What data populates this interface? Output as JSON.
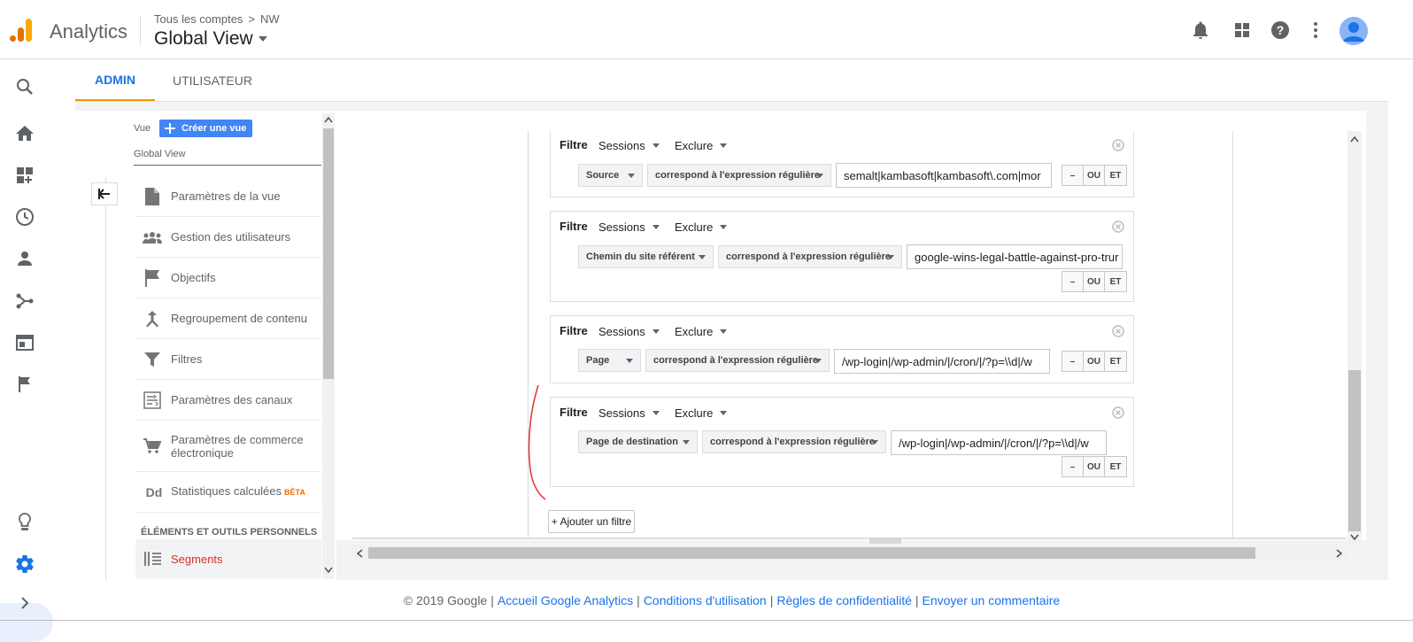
{
  "header": {
    "app_name": "Analytics",
    "breadcrumb_root": "Tous les comptes",
    "breadcrumb_sep": ">",
    "breadcrumb_account": "NW",
    "view_title": "Global View"
  },
  "tabs": {
    "admin": "ADMIN",
    "user": "UTILISATEUR"
  },
  "panel": {
    "vue_label": "Vue",
    "create_view": "Créer une vue",
    "view_name": "Global View",
    "items": [
      {
        "label": "Paramètres de la vue",
        "icon": "document-icon"
      },
      {
        "label": "Gestion des utilisateurs",
        "icon": "people-icon"
      },
      {
        "label": "Objectifs",
        "icon": "flag-icon"
      },
      {
        "label": "Regroupement de contenu",
        "icon": "merge-icon"
      },
      {
        "label": "Filtres",
        "icon": "filter-icon"
      },
      {
        "label": "Paramètres des canaux",
        "icon": "channel-icon"
      },
      {
        "label": "Paramètres de commerce électronique",
        "icon": "cart-icon"
      },
      {
        "label": "Statistiques calculées",
        "icon": "dd-icon",
        "badge": "BÊTA"
      }
    ],
    "section_personal": "ÉLÉMENTS ET OUTILS PERSONNELS",
    "segments": "Segments"
  },
  "filters": [
    {
      "label": "Filtre",
      "scope": "Sessions",
      "mode": "Exclure",
      "dimension": "Source",
      "operator": "correspond à l'expression régulière",
      "value": "semalt|kambasoft|kambasoft\\.com|mor"
    },
    {
      "label": "Filtre",
      "scope": "Sessions",
      "mode": "Exclure",
      "dimension": "Chemin du site référent",
      "operator": "correspond à l'expression régulière",
      "value": "google-wins-legal-battle-against-pro-trur"
    },
    {
      "label": "Filtre",
      "scope": "Sessions",
      "mode": "Exclure",
      "dimension": "Page",
      "operator": "correspond à l'expression régulière",
      "value": "/wp-login|/wp-admin/|/cron/|/?p=\\\\d|/w"
    },
    {
      "label": "Filtre",
      "scope": "Sessions",
      "mode": "Exclure",
      "dimension": "Page de destination",
      "operator": "correspond à l'expression régulière",
      "value": "/wp-login|/wp-admin/|/cron/|/?p=\\\\d|/w"
    }
  ],
  "buttons": {
    "minus": "–",
    "or": "OU",
    "and": "ET",
    "add_filter": "+ Ajouter un filtre"
  },
  "footer": {
    "copyright": "© 2019 Google",
    "sep": "|",
    "home": "Accueil Google Analytics",
    "terms": "Conditions d'utilisation",
    "privacy": "Règles de confidentialité",
    "feedback": "Envoyer un commentaire"
  },
  "colors": {
    "accent": "#1a73e8",
    "tab_underline": "#f29900",
    "button_blue": "#4285f4",
    "segments_red": "#d93025",
    "annotation_red": "#e53935"
  }
}
